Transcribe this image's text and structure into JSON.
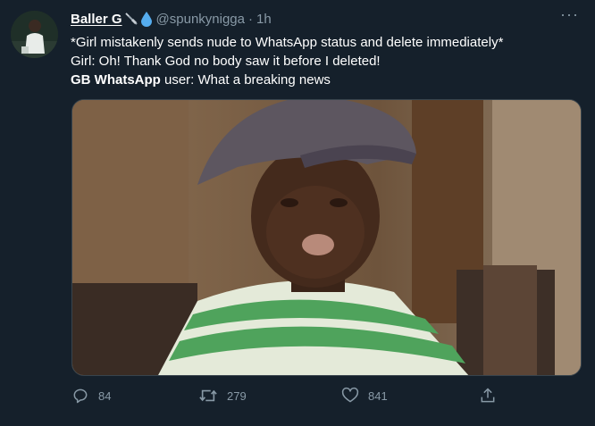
{
  "author": {
    "display_name": "Baller G",
    "emoji_1": "syringe-icon",
    "emoji_2": "droplet-icon",
    "handle": "@spunkynigga",
    "separator": "·",
    "time": "1h"
  },
  "tweet": {
    "line1": "*Girl mistakenly sends nude to WhatsApp status and delete immediately*",
    "line2": "Girl: Oh! Thank God no body saw it before I deleted!",
    "line3_bold": "GB WhatsApp",
    "line3_rest": " user: What a breaking news"
  },
  "actions": {
    "reply_count": "84",
    "retweet_count": "279",
    "like_count": "841"
  },
  "colors": {
    "background": "#15202b",
    "muted": "#8899a6",
    "accent_blue": "#1da1f2"
  }
}
